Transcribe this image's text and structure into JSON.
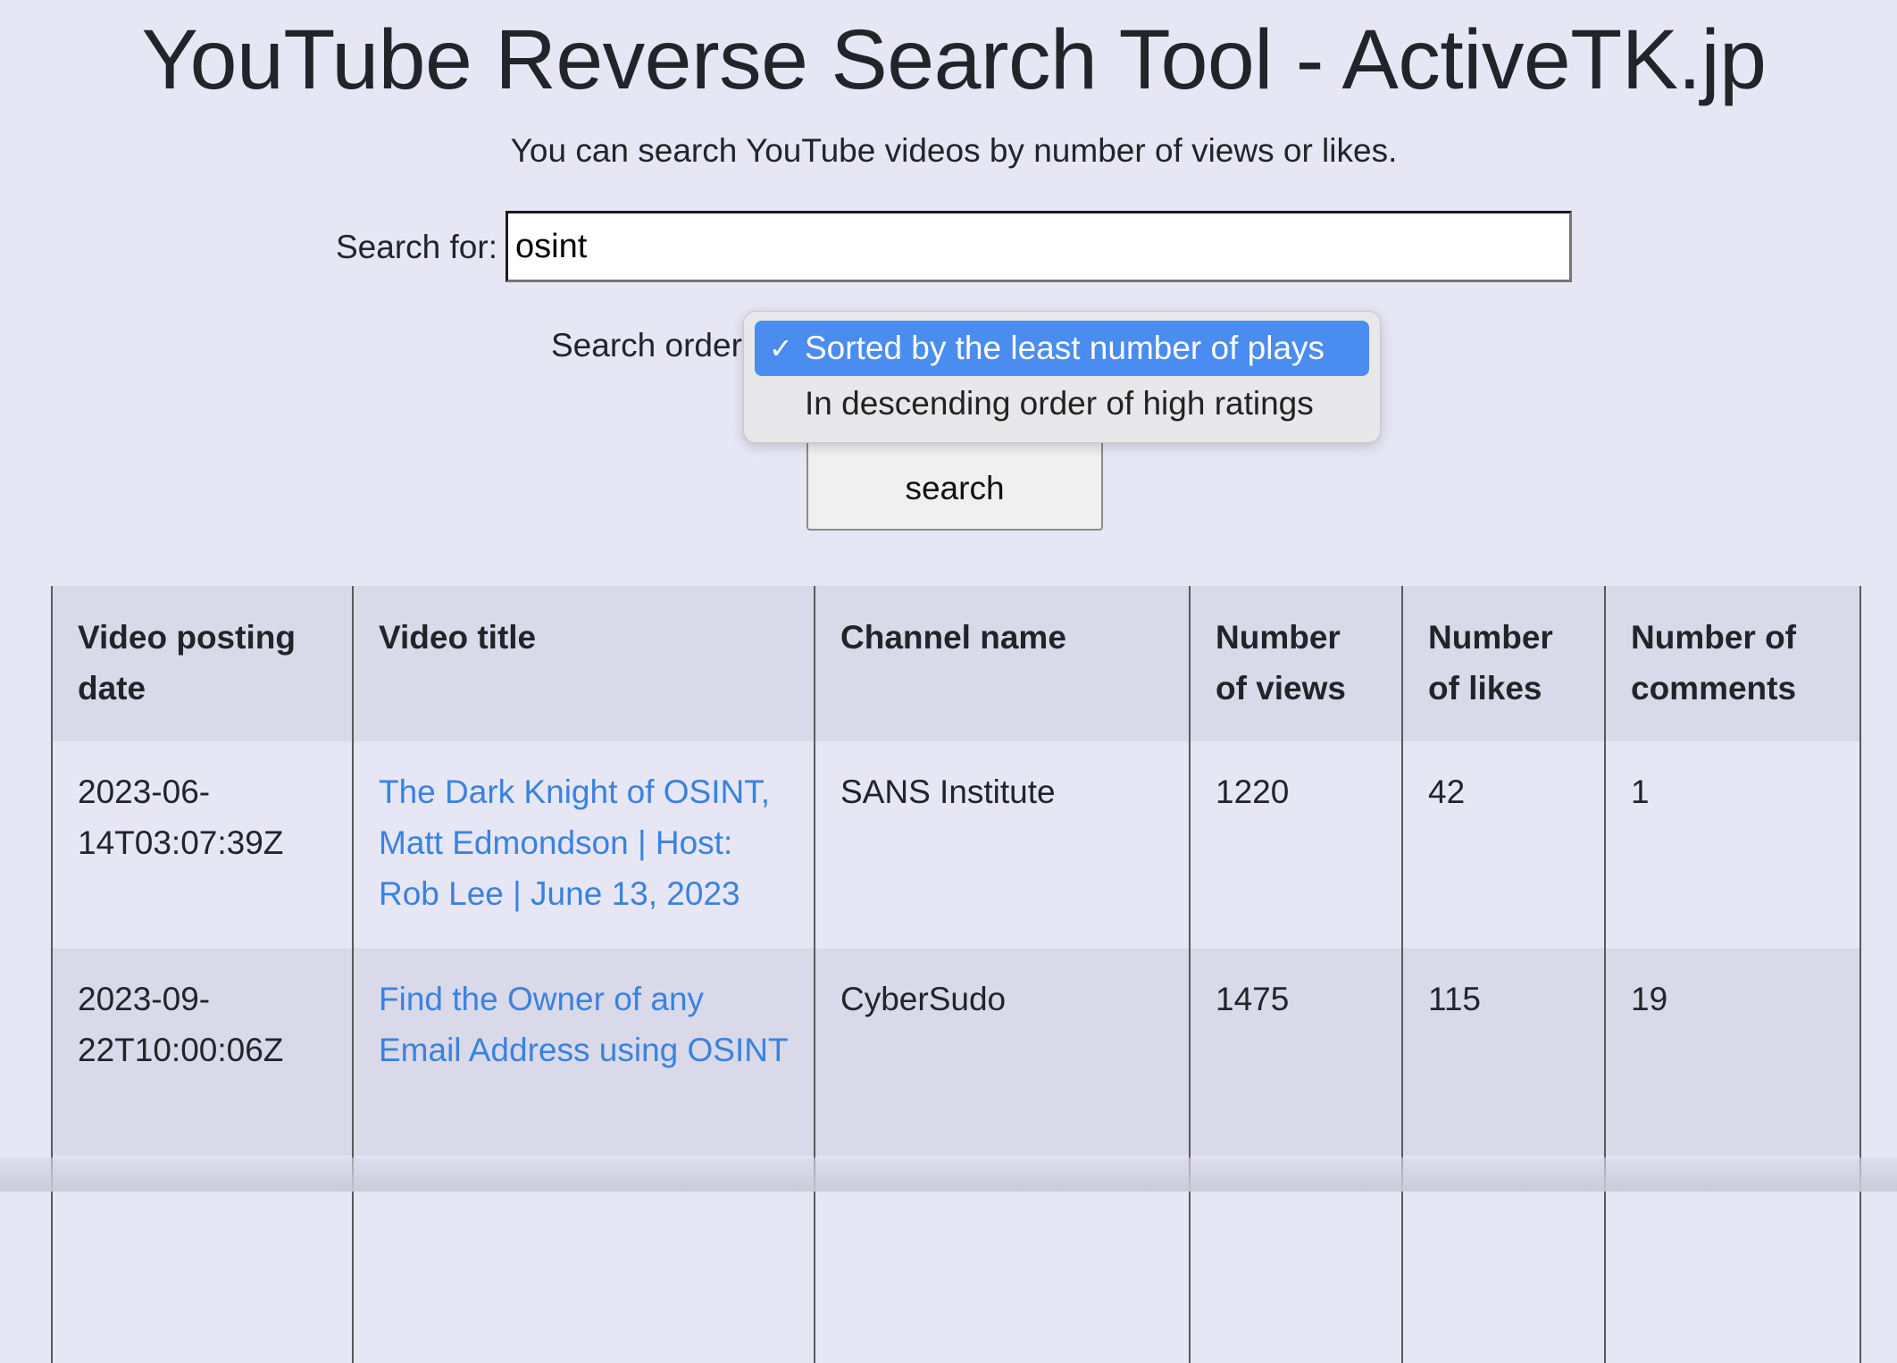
{
  "page": {
    "title": "YouTube Reverse Search Tool - ActiveTK.jp",
    "subtitle": "You can search YouTube videos by number of views or likes."
  },
  "search": {
    "label": "Search for:",
    "value": "osint",
    "button_label": "search"
  },
  "order": {
    "label": "Search order",
    "options": [
      {
        "label": "Sorted by the least number of plays",
        "selected": true
      },
      {
        "label": "In descending order of high ratings",
        "selected": false
      }
    ],
    "check_glyph": "✓"
  },
  "table": {
    "headers": [
      "Video posting date",
      "Video title",
      "Channel name",
      "Number of views",
      "Number of likes",
      "Number of comments"
    ],
    "rows": [
      {
        "date": "2023-06-14T03:07:39Z",
        "title": "The Dark Knight of OSINT, Matt Edmondson | Host: Rob Lee | June 13, 2023",
        "channel": "SANS Institute",
        "views": "1220",
        "likes": "42",
        "comments": "1"
      },
      {
        "date": "2023-09-22T10:00:06Z",
        "title": "Find the Owner of any Email Address using OSINT",
        "channel": "CyberSudo",
        "views": "1475",
        "likes": "115",
        "comments": "19"
      },
      {
        "date": "",
        "title": "",
        "channel": "",
        "views": "",
        "likes": "",
        "comments": ""
      }
    ]
  },
  "colors": {
    "background": "#e6e6f5",
    "link": "#3a82e0",
    "selected_option": "#4a8cf0"
  }
}
